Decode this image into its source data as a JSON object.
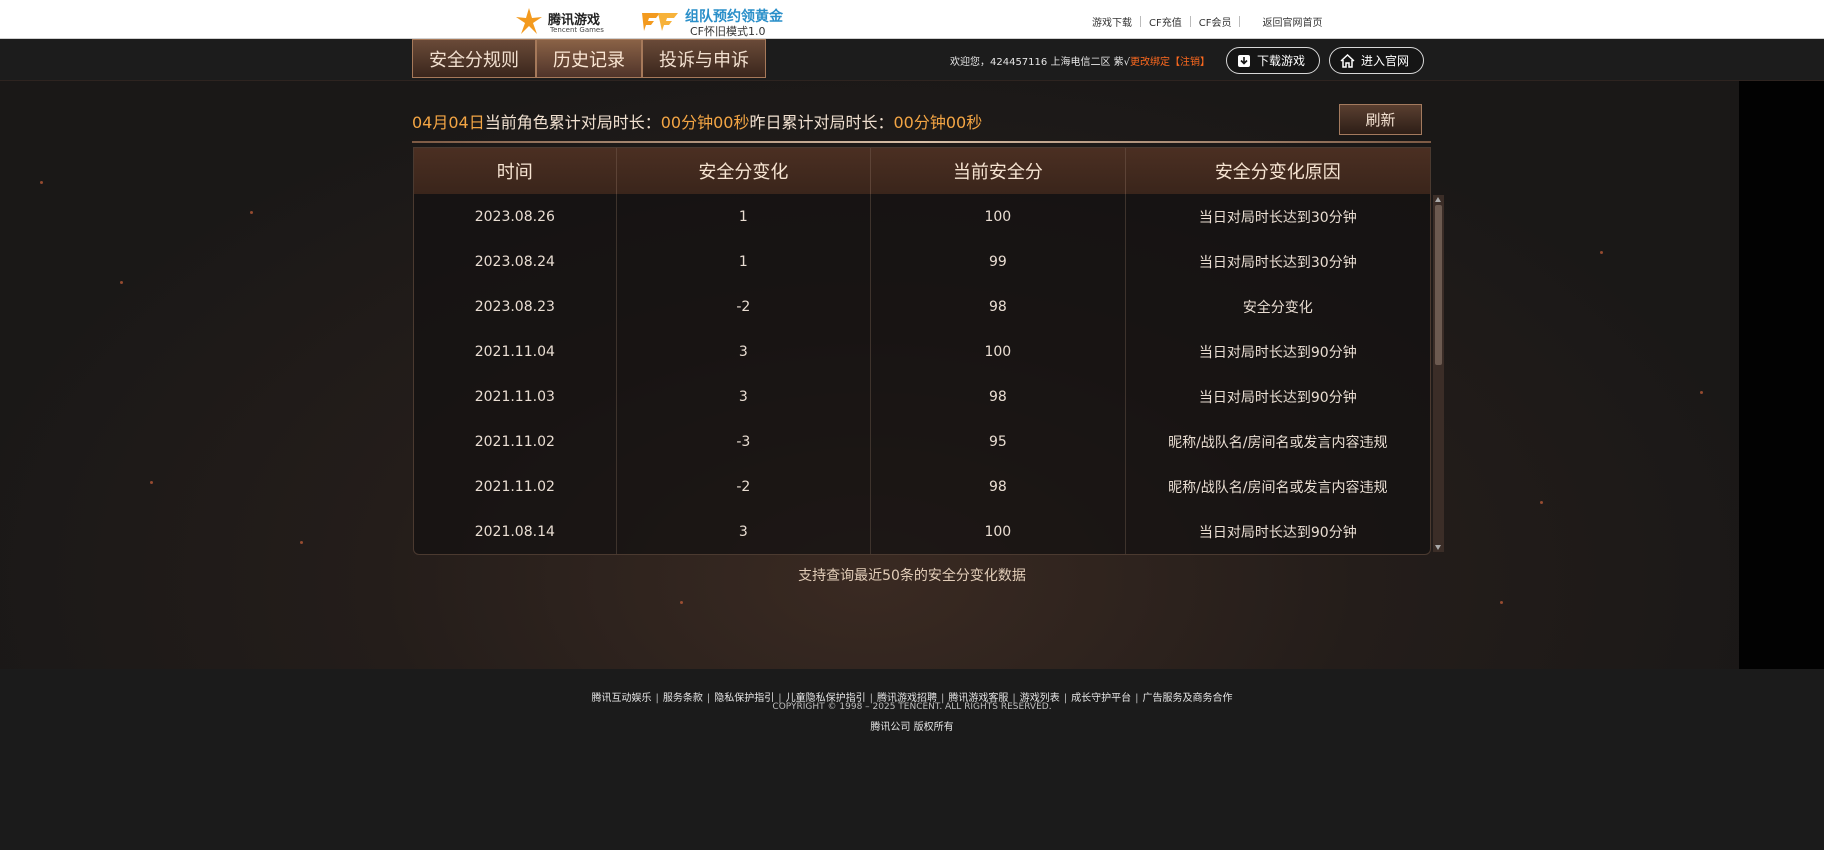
{
  "header": {
    "tencent_logo_cn": "腾讯游戏",
    "tencent_logo_en": "Tencent Games",
    "cf_logo_title": "组队预约领黄金",
    "cf_logo_sub": "CF怀旧模式1.0",
    "links": [
      "游戏下载",
      "CF充值",
      "CF会员",
      "返回官网首页"
    ]
  },
  "nav": {
    "tabs": [
      "安全分规则",
      "历史记录",
      "投诉与申诉"
    ],
    "active_tab": "历史记录",
    "welcome_prefix": "欢迎您，424457116 上海电信二区 紫√",
    "change_binding": "更改绑定",
    "logout": "【注销】",
    "download_label": "下载游戏",
    "official_label": "进入官网"
  },
  "stat": {
    "today_prefix": "04月04日",
    "today_label": "当前角色累计对局时长：",
    "today_value": "00分钟00秒",
    "yesterday_label": "昨日累计对局时长：",
    "yesterday_value": "00分钟00秒",
    "refresh_label": "刷新"
  },
  "table": {
    "headers": [
      "时间",
      "安全分变化",
      "当前安全分",
      "安全分变化原因"
    ],
    "rows": [
      [
        "2023.08.26",
        "1",
        "100",
        "当日对局时长达到30分钟"
      ],
      [
        "2023.08.24",
        "1",
        "99",
        "当日对局时长达到30分钟"
      ],
      [
        "2023.08.23",
        "-2",
        "98",
        "安全分变化"
      ],
      [
        "2021.11.04",
        "3",
        "100",
        "当日对局时长达到90分钟"
      ],
      [
        "2021.11.03",
        "3",
        "98",
        "当日对局时长达到90分钟"
      ],
      [
        "2021.11.02",
        "-3",
        "95",
        "昵称/战队名/房间名或发言内容违规"
      ],
      [
        "2021.11.02",
        "-2",
        "98",
        "昵称/战队名/房间名或发言内容违规"
      ],
      [
        "2021.08.14",
        "3",
        "100",
        "当日对局时长达到90分钟"
      ]
    ]
  },
  "note": "支持查询最近50条的安全分变化数据",
  "footer": {
    "links": [
      "腾讯互动娱乐",
      "服务条款",
      "隐私保护指引",
      "儿童隐私保护指引",
      "腾讯游戏招聘",
      "腾讯游戏客服",
      "游戏列表",
      "成长守护平台",
      "广告服务及商务合作"
    ],
    "copyright": "COPYRIGHT © 1998 – 2025 TENCENT. ALL RIGHTS RESERVED.",
    "owner": "腾讯公司 版权所有"
  },
  "colors": {
    "accent_gold": "#f3a544",
    "warning_orange": "#ff6a1f",
    "table_header": "#4b2f22"
  }
}
